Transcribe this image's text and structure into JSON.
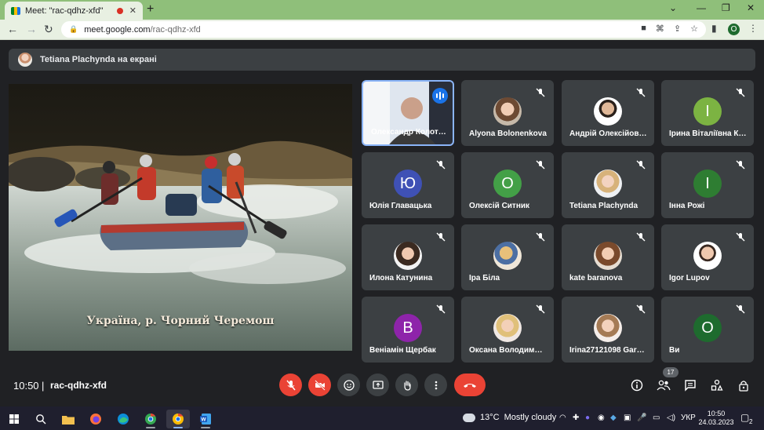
{
  "browser": {
    "tab_title": "Meet: \"rac-qdhz-xfd\"",
    "url_host": "meet.google.com",
    "url_path": "/rac-qdhz-xfd",
    "profile_initial": "O"
  },
  "presenting": {
    "text": "Tetiana Plachynda на екрані"
  },
  "screen_share": {
    "caption": "Україна, р. Чорний Черемош"
  },
  "participants": [
    {
      "name": "Олександр Колот…",
      "type": "video",
      "speaking": true
    },
    {
      "name": "Alyona Bolonenkova",
      "type": "photo",
      "muted": true
    },
    {
      "name": "Андрій Олексійов…",
      "type": "photo",
      "muted": true
    },
    {
      "name": "Ірина Віталіївна К…",
      "type": "initial",
      "initial": "І",
      "color": "#7cb342",
      "muted": true
    },
    {
      "name": "Юлія Главацька",
      "type": "initial",
      "initial": "Ю",
      "color": "#3f51b5",
      "muted": true
    },
    {
      "name": "Олексій Ситник",
      "type": "initial",
      "initial": "О",
      "color": "#43a047",
      "muted": true
    },
    {
      "name": "Tetiana Plachynda",
      "type": "photo",
      "muted": true
    },
    {
      "name": "Інна Рожі",
      "type": "initial",
      "initial": "І",
      "color": "#2e7d32",
      "muted": true
    },
    {
      "name": "Илона Катунина",
      "type": "photo",
      "muted": true
    },
    {
      "name": "Іра Біла",
      "type": "photo",
      "muted": true
    },
    {
      "name": "kate baranova",
      "type": "photo",
      "muted": true
    },
    {
      "name": "Igor Lupov",
      "type": "photo",
      "muted": true
    },
    {
      "name": "Веніамін Щербак",
      "type": "initial",
      "initial": "В",
      "color": "#8e24aa",
      "muted": true
    },
    {
      "name": "Оксана Володим…",
      "type": "photo",
      "muted": true
    },
    {
      "name": "Irina27121098 Gar…",
      "type": "photo",
      "muted": true
    },
    {
      "name": "Ви",
      "type": "initial",
      "initial": "О",
      "color": "#1e6b2e",
      "muted": true
    }
  ],
  "meeting": {
    "time": "10:50",
    "separator": "|",
    "code": "rac-qdhz-xfd",
    "participant_count": "17"
  },
  "controls": [
    "mic-off",
    "camera-off",
    "emoji",
    "present",
    "raise-hand",
    "more",
    "leave"
  ],
  "taskbar": {
    "temperature": "13°C",
    "weather": "Mostly cloudy",
    "language": "УКР",
    "time": "10:50",
    "date": "24.03.2023",
    "notification_count": "2"
  },
  "colors": {
    "meet_bg": "#202124",
    "tile_bg": "#3c4043",
    "danger": "#ea4335",
    "accent": "#8ab4f8",
    "chrome_tabstrip": "#8fbf7a"
  }
}
